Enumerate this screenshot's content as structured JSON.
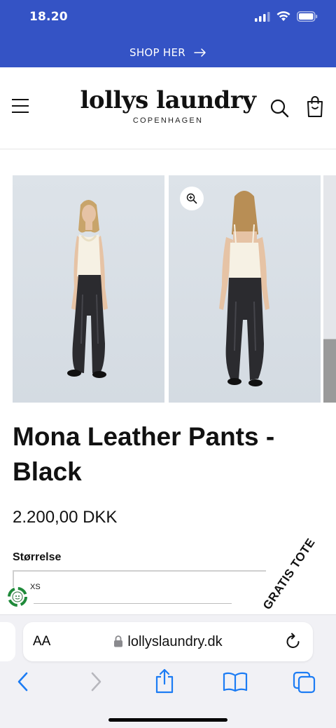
{
  "status_bar": {
    "time": "18.20"
  },
  "announcement": {
    "text": "SHOP HER",
    "arrow_icon": "arrow-right-icon"
  },
  "header": {
    "logo_main": "lollys laundry",
    "logo_sub": "COPENHAGEN",
    "icons": [
      "hamburger-icon",
      "search-icon",
      "bag-icon"
    ]
  },
  "product": {
    "title": "Mona Leather Pants - Black",
    "price": "2.200,00 DKK",
    "size_label": "Størrelse",
    "size_value": "XS"
  },
  "promo": {
    "badge_text": "GRATIS TOTE"
  },
  "browser": {
    "aa_label": "AA",
    "url": "lollyslaundry.dk"
  },
  "colors": {
    "brand_blue": "#3453c5",
    "text": "#121212",
    "ios_blue": "#1c7cf4"
  }
}
